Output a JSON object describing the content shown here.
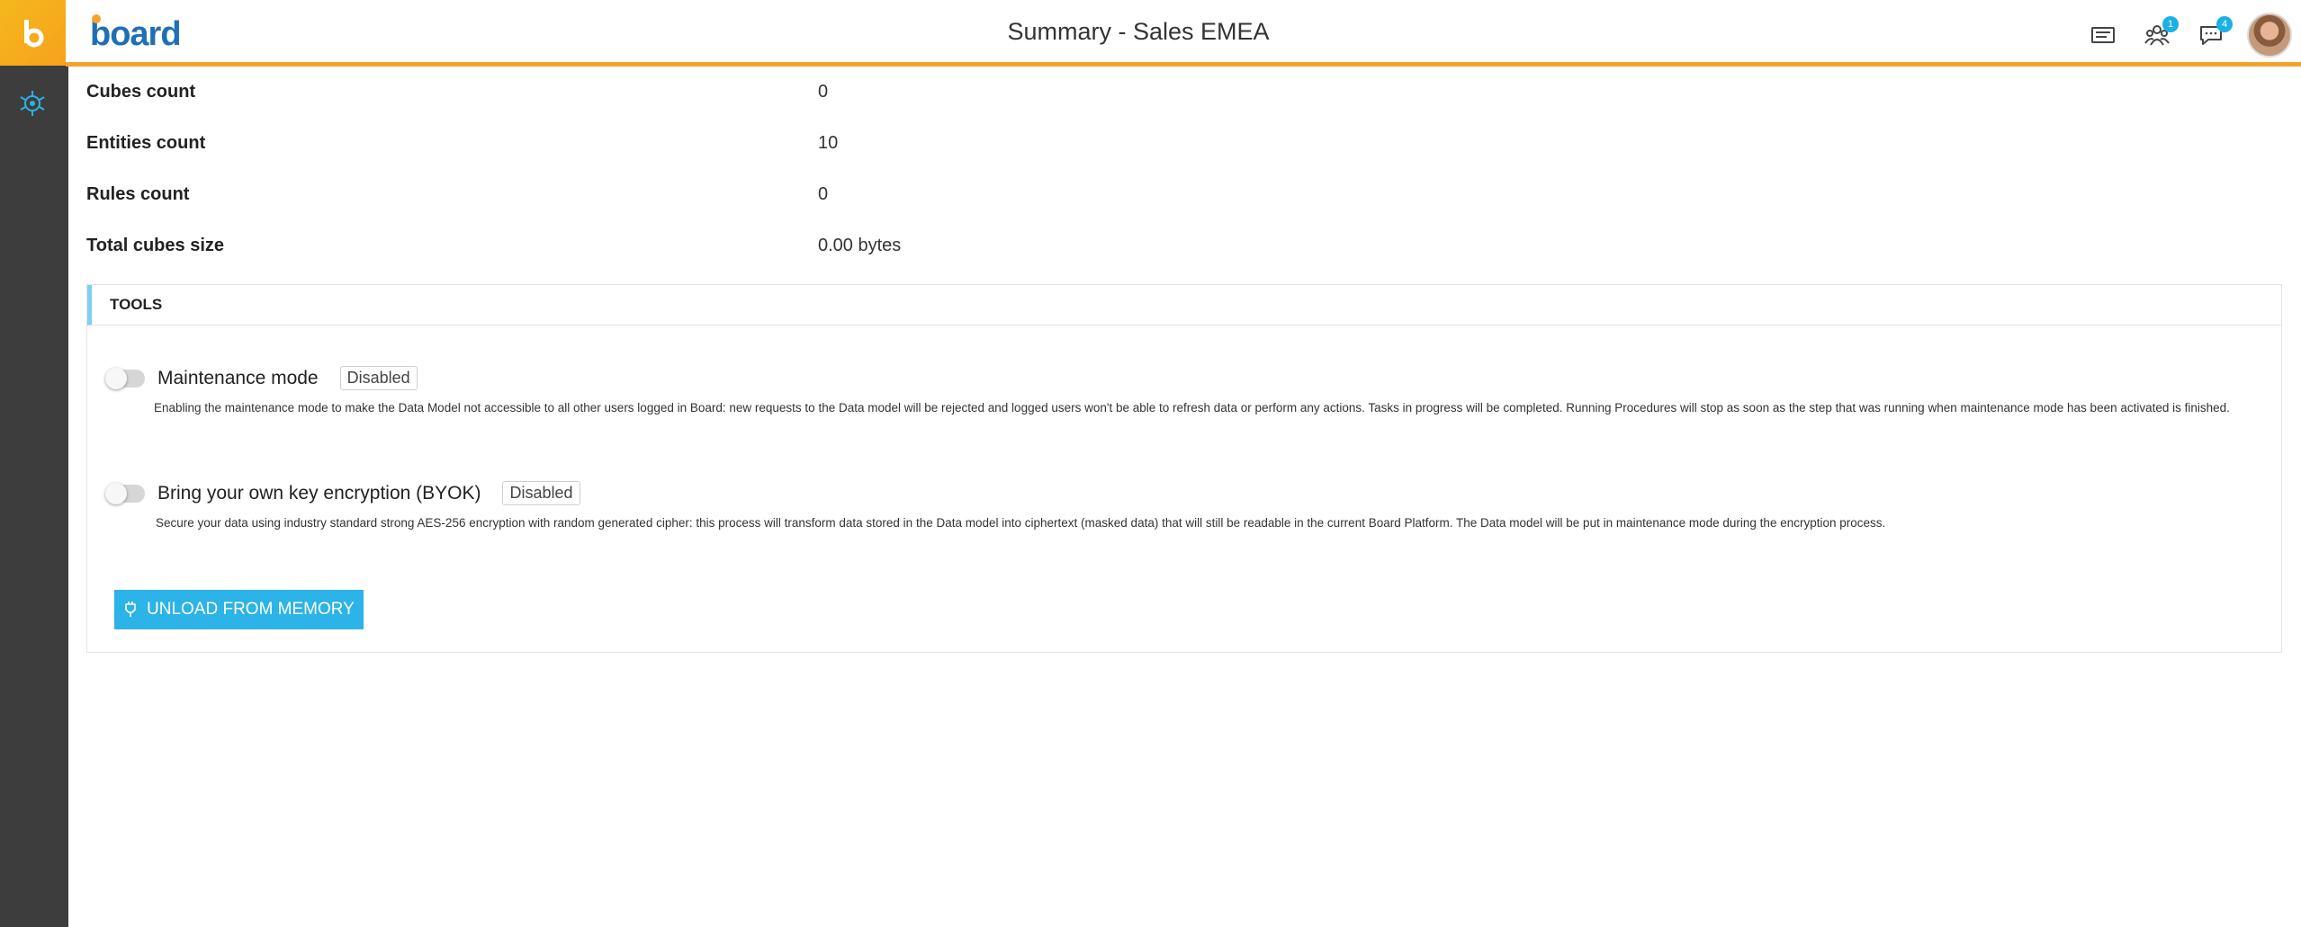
{
  "header": {
    "brand": "board",
    "title": "Summary - Sales EMEA",
    "icons": [
      {
        "name": "notes-icon",
        "badge": ""
      },
      {
        "name": "collaboration-icon",
        "badge": "1"
      },
      {
        "name": "chat-icon",
        "badge": "4"
      }
    ]
  },
  "stats": [
    {
      "label": "Cubes count",
      "value": "0"
    },
    {
      "label": "Entities count",
      "value": "10"
    },
    {
      "label": "Rules count",
      "value": "0"
    },
    {
      "label": "Total cubes size",
      "value": "0.00 bytes"
    }
  ],
  "tools": {
    "title": "TOOLS",
    "maintenance": {
      "label": "Maintenance mode",
      "status": "Disabled",
      "description": "Enabling the maintenance mode to make the Data Model not accessible to all other users logged in Board: new requests to the Data model will be rejected and logged users won't be able to refresh data or perform any actions. Tasks in progress will be completed. Running Procedures will stop as soon as the step that was running when maintenance mode has been activated is finished."
    },
    "byok": {
      "label": "Bring your own key encryption (BYOK)",
      "status": "Disabled",
      "description": "Secure your data using industry standard strong AES-256 encryption with random generated cipher: this process will transform data stored in the Data model into ciphertext (masked data) that will still be readable in the current Board Platform. The Data model will be put in maintenance mode during the encryption process."
    },
    "unload_label": "UNLOAD FROM MEMORY"
  },
  "colors": {
    "accent": "#f4a32a",
    "primary": "#2cb3e7",
    "rail": "#3d3d3d"
  }
}
